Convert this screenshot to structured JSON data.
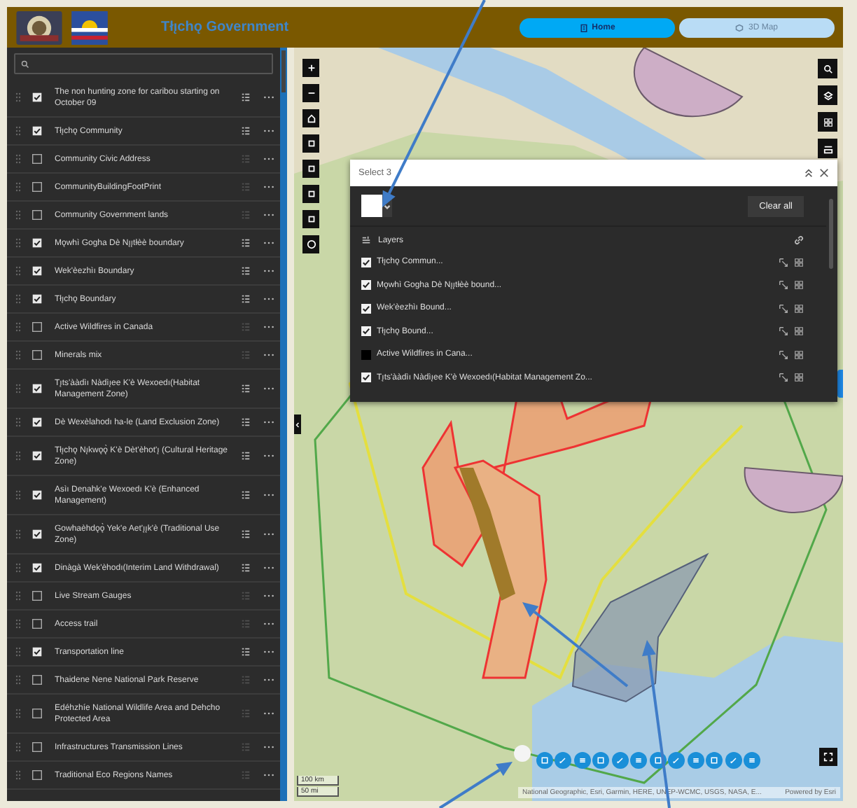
{
  "header": {
    "title": "Tłı̨chǫ Government",
    "tabs": [
      {
        "label": "Home",
        "selected": true
      },
      {
        "label": "3D Map",
        "selected": false
      }
    ]
  },
  "sidebar": {
    "layers": [
      {
        "label": "The non hunting zone for caribou starting on October 09",
        "checked": true
      },
      {
        "label": "Tłı̨chǫ Community",
        "checked": true
      },
      {
        "label": "Community Civic Address",
        "checked": false
      },
      {
        "label": "CommunityBuildingFootPrint",
        "checked": false
      },
      {
        "label": "Community Government lands",
        "checked": false
      },
      {
        "label": "Mǫwhì Gogha Dè Nı̨ı̨tłèè boundary",
        "checked": true
      },
      {
        "label": "Wek'èezhìı Boundary",
        "checked": true
      },
      {
        "label": "Tłı̨chǫ Boundary",
        "checked": true
      },
      {
        "label": "Active Wildfires in Canada",
        "checked": false
      },
      {
        "label": "Minerals mix",
        "checked": false
      },
      {
        "label": "Tı̨ts'ààdìı Nàdìı̨ee K'è Wexoedı(Habitat Management Zone)",
        "checked": true
      },
      {
        "label": "Dè Wexèlahodı ha-le (Land Exclusion Zone)",
        "checked": true
      },
      {
        "label": "Tłı̨chǫ Nı̨kwǫǫ̀ K'è Dèt'èhot'ı̨ (Cultural Heritage Zone)",
        "checked": true
      },
      {
        "label": "Asìı Denahk'e Wexoedı K'è (Enhanced Management)",
        "checked": true
      },
      {
        "label": "Gowhaèhdǫǫ̀ Yek'e Aet'ı̨ı̨k'è (Traditional Use Zone)",
        "checked": true
      },
      {
        "label": "Dinàgà Wek'èhodı(Interim Land Withdrawal)",
        "checked": true
      },
      {
        "label": "Live Stream Gauges",
        "checked": false
      },
      {
        "label": "Access trail",
        "checked": false
      },
      {
        "label": "Transportation line",
        "checked": true
      },
      {
        "label": "Thaidene Nene National Park Reserve",
        "checked": false
      },
      {
        "label": "Edéhzhíe National Wildlife Area and Dehcho Protected Area",
        "checked": false
      },
      {
        "label": "Infrastructures Transmission Lines",
        "checked": false
      },
      {
        "label": "Traditional Eco Regions Names",
        "checked": false
      }
    ]
  },
  "map": {
    "select_panel": {
      "title": "Select 3",
      "clear_button": "Clear all",
      "layers_heading": "Layers",
      "layers": [
        {
          "label": "Tłı̨chǫ Commun...",
          "checked": true
        },
        {
          "label": "Mǫwhì Gogha Dè Nı̨ı̨tłèè bound...",
          "checked": true
        },
        {
          "label": "Wek'èezhìı Bound...",
          "checked": true
        },
        {
          "label": "Tłı̨chǫ Bound...",
          "checked": true
        },
        {
          "label": "Active Wildfires in Cana...",
          "checked": false
        },
        {
          "label": "Tı̨ts'ààdìı Nàdìı̨ee K'è Wexoedı(Habitat Management Zo...",
          "checked": true
        }
      ]
    },
    "scale": [
      "100 km",
      "50 mi"
    ],
    "attribution": "National Geographic, Esri, Garmin, HERE, UNEP-WCMC, USGS, NASA, E...",
    "powered_by": "Powered by Esri"
  }
}
